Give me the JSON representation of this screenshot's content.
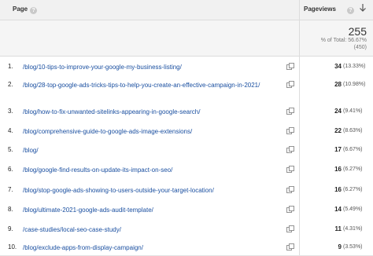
{
  "header": {
    "page_label": "Page",
    "pageviews_label": "Pageviews"
  },
  "summary": {
    "total": "255",
    "pct_of_total": "% of Total: 56.67%",
    "abs_total": "(450)"
  },
  "rows": [
    {
      "num": "1.",
      "page": "/blog/10-tips-to-improve-your-google-my-business-listing/",
      "views": "34",
      "pct": "(13.33%)"
    },
    {
      "num": "2.",
      "page": "/blog/28-top-google-ads-tricks-tips-to-help-you-create-an-effective-campaign-in-2021/",
      "views": "28",
      "pct": "(10.98%)"
    },
    {
      "num": "3.",
      "page": "/blog/how-to-fix-unwanted-sitelinks-appearing-in-google-search/",
      "views": "24",
      "pct": "(9.41%)"
    },
    {
      "num": "4.",
      "page": "/blog/comprehensive-guide-to-google-ads-image-extensions/",
      "views": "22",
      "pct": "(8.63%)"
    },
    {
      "num": "5.",
      "page": "/blog/",
      "views": "17",
      "pct": "(6.67%)"
    },
    {
      "num": "6.",
      "page": "/blog/google-find-results-on-update-its-impact-on-seo/",
      "views": "16",
      "pct": "(6.27%)"
    },
    {
      "num": "7.",
      "page": "/blog/stop-google-ads-showing-to-users-outside-your-target-location/",
      "views": "16",
      "pct": "(6.27%)"
    },
    {
      "num": "8.",
      "page": "/blog/ultimate-2021-google-ads-audit-template/",
      "views": "14",
      "pct": "(5.49%)"
    },
    {
      "num": "9.",
      "page": "/case-studies/local-seo-case-study/",
      "views": "11",
      "pct": "(4.31%)"
    },
    {
      "num": "10.",
      "page": "/blog/exclude-apps-from-display-campaign/",
      "views": "9",
      "pct": "(3.53%)"
    }
  ],
  "icons": {
    "external_link": "external-link-icon",
    "sort": "sort-descending-icon",
    "help": "help-icon"
  }
}
